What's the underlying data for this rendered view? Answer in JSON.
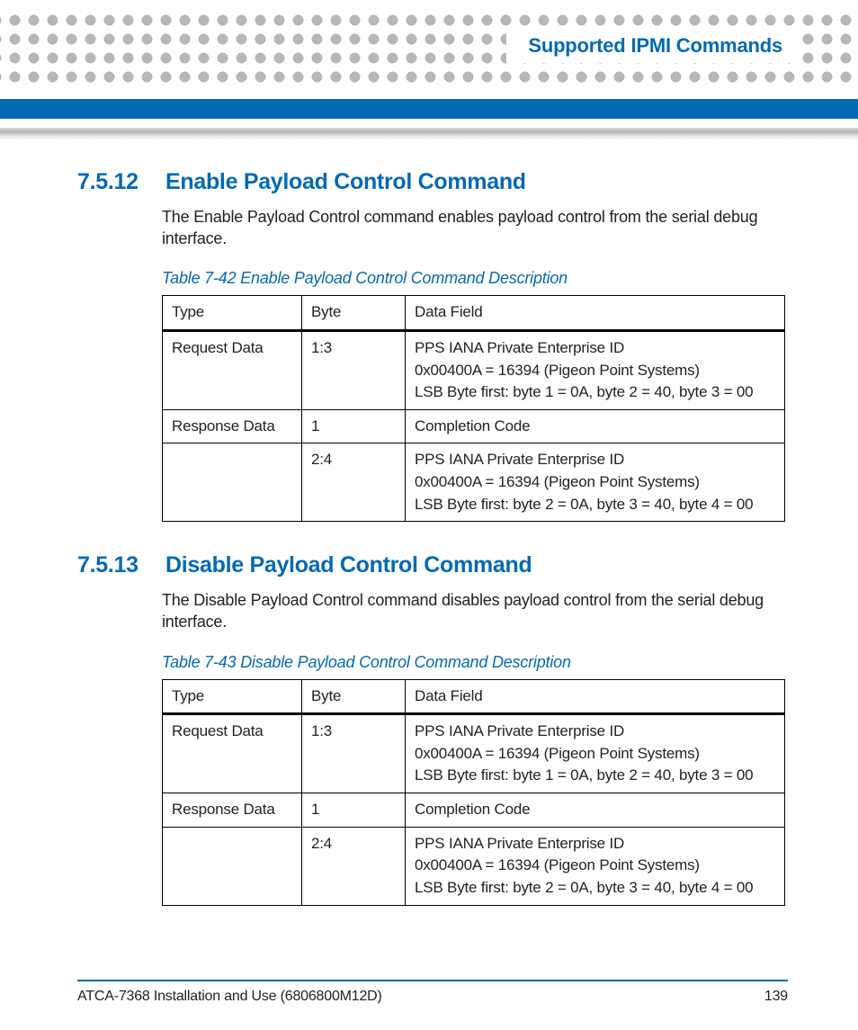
{
  "header": {
    "chapter_title": "Supported IPMI Commands"
  },
  "sections": [
    {
      "number": "7.5.12",
      "title": "Enable Payload Control Command",
      "paragraph": "The Enable Payload Control command enables payload control from the serial debug interface.",
      "table_caption": "Table 7-42 Enable Payload Control Command Description",
      "table": {
        "headers": [
          "Type",
          "Byte",
          "Data Field"
        ],
        "rows": [
          {
            "type": "Request Data",
            "byte": "1:3",
            "field": "PPS IANA Private Enterprise ID\n0x00400A = 16394 (Pigeon Point Systems)\nLSB Byte first: byte 1 = 0A, byte 2 = 40, byte 3 = 00"
          },
          {
            "type": "Response Data",
            "byte": "1",
            "field": "Completion Code"
          },
          {
            "type": "",
            "byte": "2:4",
            "field": "PPS IANA Private Enterprise ID\n0x00400A = 16394 (Pigeon Point Systems)\nLSB Byte first: byte 2 = 0A, byte 3 = 40, byte 4 = 00"
          }
        ]
      }
    },
    {
      "number": "7.5.13",
      "title": "Disable Payload Control Command",
      "paragraph": "The Disable Payload Control command disables payload control from the serial debug interface.",
      "table_caption": "Table 7-43 Disable Payload Control Command Description",
      "table": {
        "headers": [
          "Type",
          "Byte",
          "Data Field"
        ],
        "rows": [
          {
            "type": "Request Data",
            "byte": "1:3",
            "field": "PPS IANA Private Enterprise ID\n0x00400A = 16394 (Pigeon Point Systems)\nLSB Byte first: byte 1 = 0A, byte 2 = 40, byte 3 = 00"
          },
          {
            "type": "Response Data",
            "byte": "1",
            "field": "Completion Code"
          },
          {
            "type": "",
            "byte": "2:4",
            "field": "PPS IANA Private Enterprise ID\n0x00400A = 16394 (Pigeon Point Systems)\nLSB Byte first: byte 2 = 0A, byte 3 = 40, byte 4 = 00"
          }
        ]
      }
    }
  ],
  "footer": {
    "doc_title": "ATCA-7368 Installation and Use (6806800M12D)",
    "page_number": "139"
  }
}
